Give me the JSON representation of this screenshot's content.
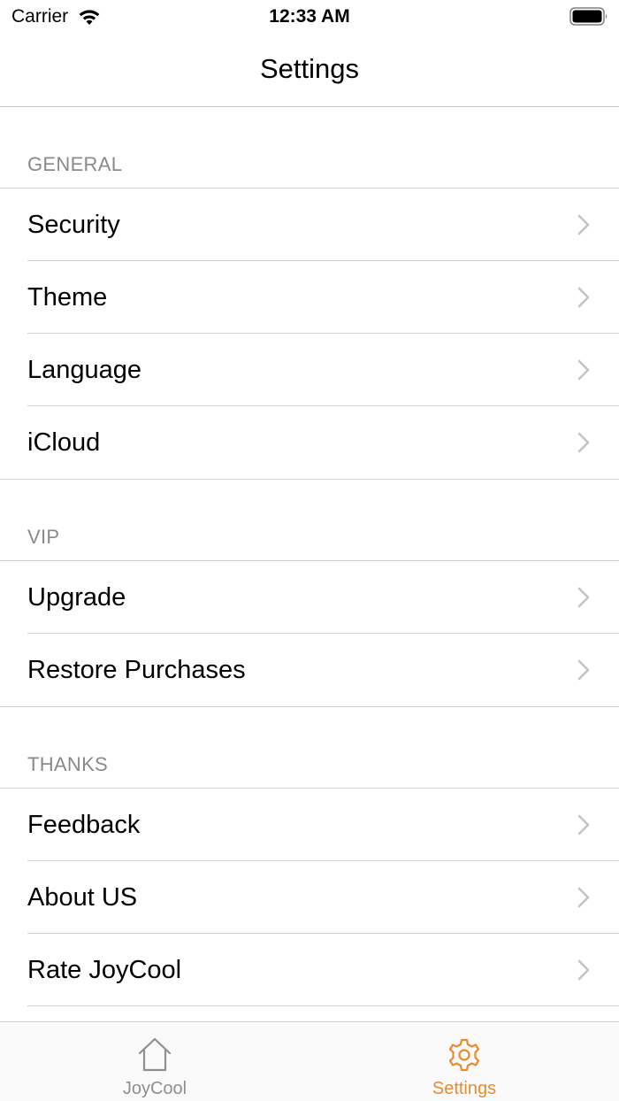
{
  "status_bar": {
    "carrier": "Carrier",
    "time": "12:33 AM"
  },
  "nav": {
    "title": "Settings"
  },
  "sections": [
    {
      "header": "GENERAL",
      "items": [
        {
          "label": "Security"
        },
        {
          "label": "Theme"
        },
        {
          "label": "Language"
        },
        {
          "label": "iCloud"
        }
      ]
    },
    {
      "header": "VIP",
      "items": [
        {
          "label": "Upgrade"
        },
        {
          "label": "Restore Purchases"
        }
      ]
    },
    {
      "header": "THANKS",
      "items": [
        {
          "label": "Feedback"
        },
        {
          "label": "About US"
        },
        {
          "label": "Rate JoyCool"
        }
      ]
    }
  ],
  "tab_bar": {
    "tabs": [
      {
        "label": "JoyCool",
        "icon": "home-icon",
        "selected": false
      },
      {
        "label": "Settings",
        "icon": "gear-icon",
        "selected": true
      }
    ],
    "accent_color": "#E98A2C",
    "inactive_color": "#8E8E93"
  }
}
